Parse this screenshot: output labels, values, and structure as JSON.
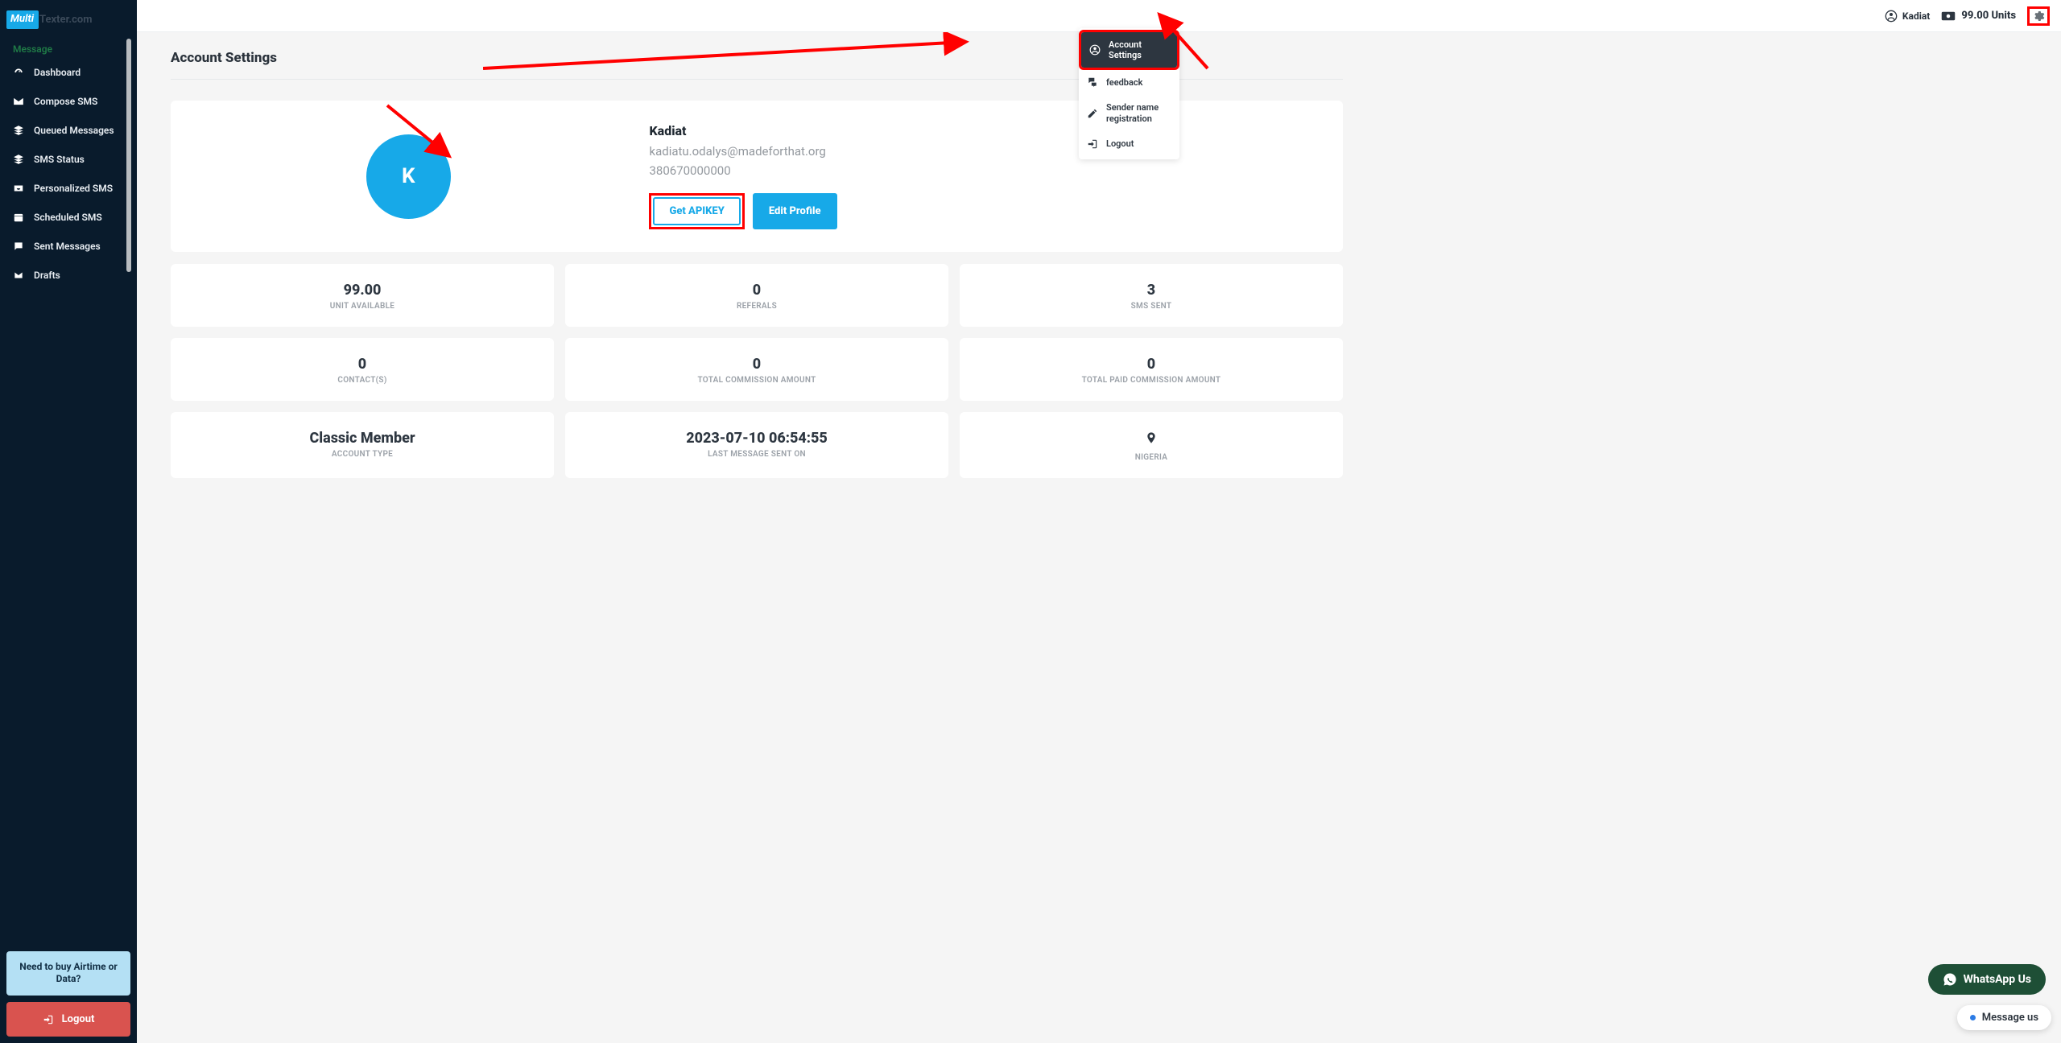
{
  "logo": {
    "badge": "Multi",
    "rest": "Texter.com"
  },
  "sidebar": {
    "section": "Message",
    "items": [
      {
        "label": "Dashboard"
      },
      {
        "label": "Compose SMS"
      },
      {
        "label": "Queued Messages"
      },
      {
        "label": "SMS Status"
      },
      {
        "label": "Personalized SMS"
      },
      {
        "label": "Scheduled SMS"
      },
      {
        "label": "Sent Messages"
      },
      {
        "label": "Drafts"
      }
    ],
    "airtime_cta": "Need to buy Airtime or Data?",
    "logout": "Logout"
  },
  "topbar": {
    "username": "Kadiat",
    "units": "99.00 Units"
  },
  "dropdown": {
    "items": [
      {
        "label": "Account Settings"
      },
      {
        "label": "feedback"
      },
      {
        "label": "Sender name registration"
      },
      {
        "label": "Logout"
      }
    ]
  },
  "page": {
    "title": "Account Settings"
  },
  "profile": {
    "initial": "K",
    "name": "Kadiat",
    "email": "kadiatu.odalys@madeforthat.org",
    "phone": "380670000000",
    "apikey_btn": "Get APIKEY",
    "edit_btn": "Edit Profile"
  },
  "stats": [
    {
      "value": "99.00",
      "label": "UNIT AVAILABLE"
    },
    {
      "value": "0",
      "label": "REFERALS"
    },
    {
      "value": "3",
      "label": "SMS SENT"
    },
    {
      "value": "0",
      "label": "CONTACT(S)"
    },
    {
      "value": "0",
      "label": "TOTAL COMMISSION AMOUNT"
    },
    {
      "value": "0",
      "label": "TOTAL PAID COMMISSION AMOUNT"
    },
    {
      "value": "Classic Member",
      "label": "ACCOUNT TYPE"
    },
    {
      "value": "2023-07-10 06:54:55",
      "label": "LAST MESSAGE SENT ON"
    },
    {
      "value": "NIGERIA",
      "label": "",
      "icon": "pin"
    }
  ],
  "whatsapp": "WhatsApp Us",
  "message_us": "Message us"
}
